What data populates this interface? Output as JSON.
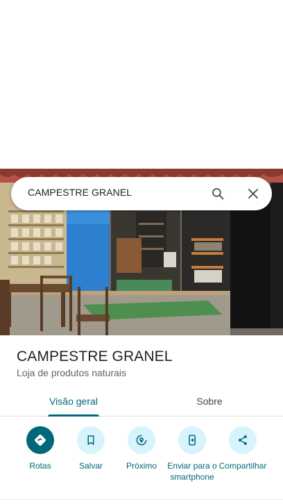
{
  "search": {
    "query": "CAMPESTRE GRANEL",
    "search_icon": "search-icon",
    "close_icon": "close-icon"
  },
  "place": {
    "name": "CAMPESTRE GRANEL",
    "category": "Loja de produtos naturais"
  },
  "tabs": [
    {
      "label": "Visão geral",
      "selected": true
    },
    {
      "label": "Sobre",
      "selected": false
    }
  ],
  "actions": [
    {
      "label": "Rotas",
      "icon": "directions-icon"
    },
    {
      "label": "Salvar",
      "icon": "bookmark-icon"
    },
    {
      "label": "Próximo",
      "icon": "nearby-icon"
    },
    {
      "label": "Enviar para o smartphone",
      "icon": "send-to-phone-icon"
    },
    {
      "label": "Compartilhar",
      "icon": "share-icon"
    }
  ],
  "colors": {
    "accent": "#00687a",
    "action_bg": "#d7f3fb"
  }
}
